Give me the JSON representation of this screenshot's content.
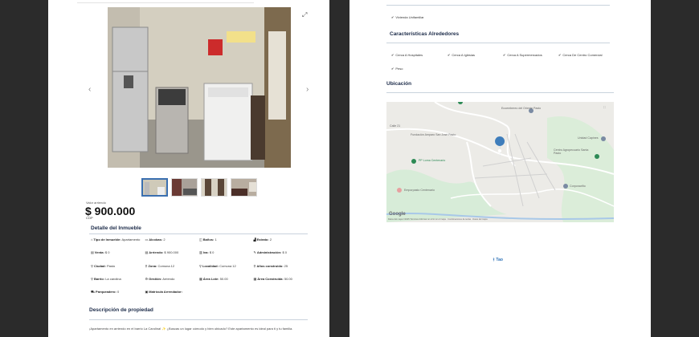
{
  "price": {
    "label": "Valor arriendo",
    "amount": "$ 900.000",
    "currency": "COP"
  },
  "details": {
    "title": "Detalle del Inmueble",
    "rows": [
      [
        {
          "icon": "home-icon",
          "glyph": "⌂",
          "label": "Tipo de Inmueble:",
          "value": "Apartamento"
        },
        {
          "icon": "bed-icon",
          "glyph": "▭",
          "label": "Alcobas:",
          "value": "2"
        },
        {
          "icon": "bath-icon",
          "glyph": "◫",
          "label": "Baños:",
          "value": "1"
        },
        {
          "icon": "stratum-icon",
          "glyph": "▟",
          "label": "Estrato:",
          "value": "2"
        }
      ],
      [
        {
          "icon": "sale-icon",
          "glyph": "▤",
          "label": "Venta:",
          "value": "$ 0"
        },
        {
          "icon": "rent-icon",
          "glyph": "▤",
          "label": "Arriendo:",
          "value": "$ 900.000"
        },
        {
          "icon": "tax-icon",
          "glyph": "▥",
          "label": "Iva:",
          "value": "$ 0"
        },
        {
          "icon": "admin-icon",
          "glyph": "✎",
          "label": "Administración:",
          "value": "$ 0"
        }
      ],
      [
        {
          "icon": "location-icon",
          "glyph": "⚲",
          "label": "Ciudad:",
          "value": "Pasto"
        },
        {
          "icon": "location-icon",
          "glyph": "⚲",
          "label": "Zona:",
          "value": "Comuna 12"
        },
        {
          "icon": "location-icon",
          "glyph": "⚲",
          "label": "Localidad:",
          "value": "Comuna 12"
        },
        {
          "icon": "location-icon",
          "glyph": "⚲",
          "label": "Años construido:",
          "value": "25"
        }
      ],
      [
        {
          "icon": "location-icon",
          "glyph": "⚲",
          "label": "Barrio:",
          "value": "La carolina"
        },
        {
          "icon": "management-icon",
          "glyph": "⚙",
          "label": "Gestión:",
          "value": "Arriendo"
        },
        {
          "icon": "area-icon",
          "glyph": "▦",
          "label": "Área Lote:",
          "value": "50.00"
        },
        {
          "icon": "area-icon",
          "glyph": "▦",
          "label": "Área Construida:",
          "value": "50.00"
        }
      ],
      [
        {
          "icon": "parking-icon",
          "glyph": "⛟",
          "label": "Parqueadero:",
          "value": "0"
        },
        {
          "icon": "registry-icon",
          "glyph": "▣",
          "label": "Matrícula Arrendador:",
          "value": ""
        },
        {
          "icon": "",
          "glyph": "",
          "label": "",
          "value": ""
        },
        {
          "icon": "",
          "glyph": "",
          "label": "",
          "value": ""
        }
      ]
    ]
  },
  "description": {
    "title": "Descripción de propiedad",
    "text": "¡Apartamento en arriendo en el barrio La Carolina! ✨ ¿Buscas un lugar cómodo y bien ubicado? Este apartamento es ideal para ti y tu familia."
  },
  "right": {
    "top_item": "Vivienda Unifamiliar",
    "surroundings_title": "Características Alrededores",
    "surroundings": [
      "Cerca A Hospitales",
      "Cerca A Iglesias",
      "Cerca A Supermercados",
      "Cerca De Centro Comercial",
      "Peso"
    ],
    "location_title": "Ubicación",
    "map": {
      "poi_1": "Ecoembereo del Oriente Pasto",
      "poi_2": "Fundación Amparo San José Pasto",
      "poi_3": "PP Loma Centenario",
      "poi_4": "Unidad Capines",
      "poi_5": "Centro Agropecuario Santa Pasto",
      "poi_6": "Corponariño",
      "poi_7": "Emporpasto Centenario",
      "street_1": "Calle 21",
      "google": "Google",
      "attribution": "Datos del mapa ©2025 Términos Informar un error en el mapa · Combinaciones de teclas · Datos del mapa"
    },
    "brand": "Tao",
    "colors": {
      "accent": "#1b2a48",
      "pin": "#3e7dbb",
      "poi": "#2d8a55"
    }
  }
}
